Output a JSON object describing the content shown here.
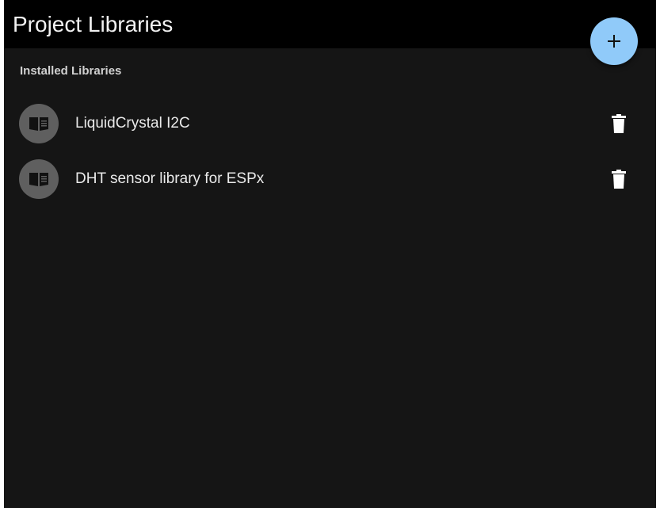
{
  "header": {
    "title": "Project Libraries"
  },
  "fab": {
    "icon": "plus-icon",
    "color": "#90caf9"
  },
  "section": {
    "subheader": "Installed Libraries"
  },
  "libraries": [
    {
      "name": "LiquidCrystal I2C",
      "icon": "book-icon",
      "action_icon": "trash-icon"
    },
    {
      "name": "DHT sensor library for ESPx",
      "icon": "book-icon",
      "action_icon": "trash-icon"
    }
  ],
  "colors": {
    "header_bg": "#000000",
    "panel_bg": "#151515",
    "avatar_bg": "#5f5f5f",
    "text": "#eaeaea"
  }
}
